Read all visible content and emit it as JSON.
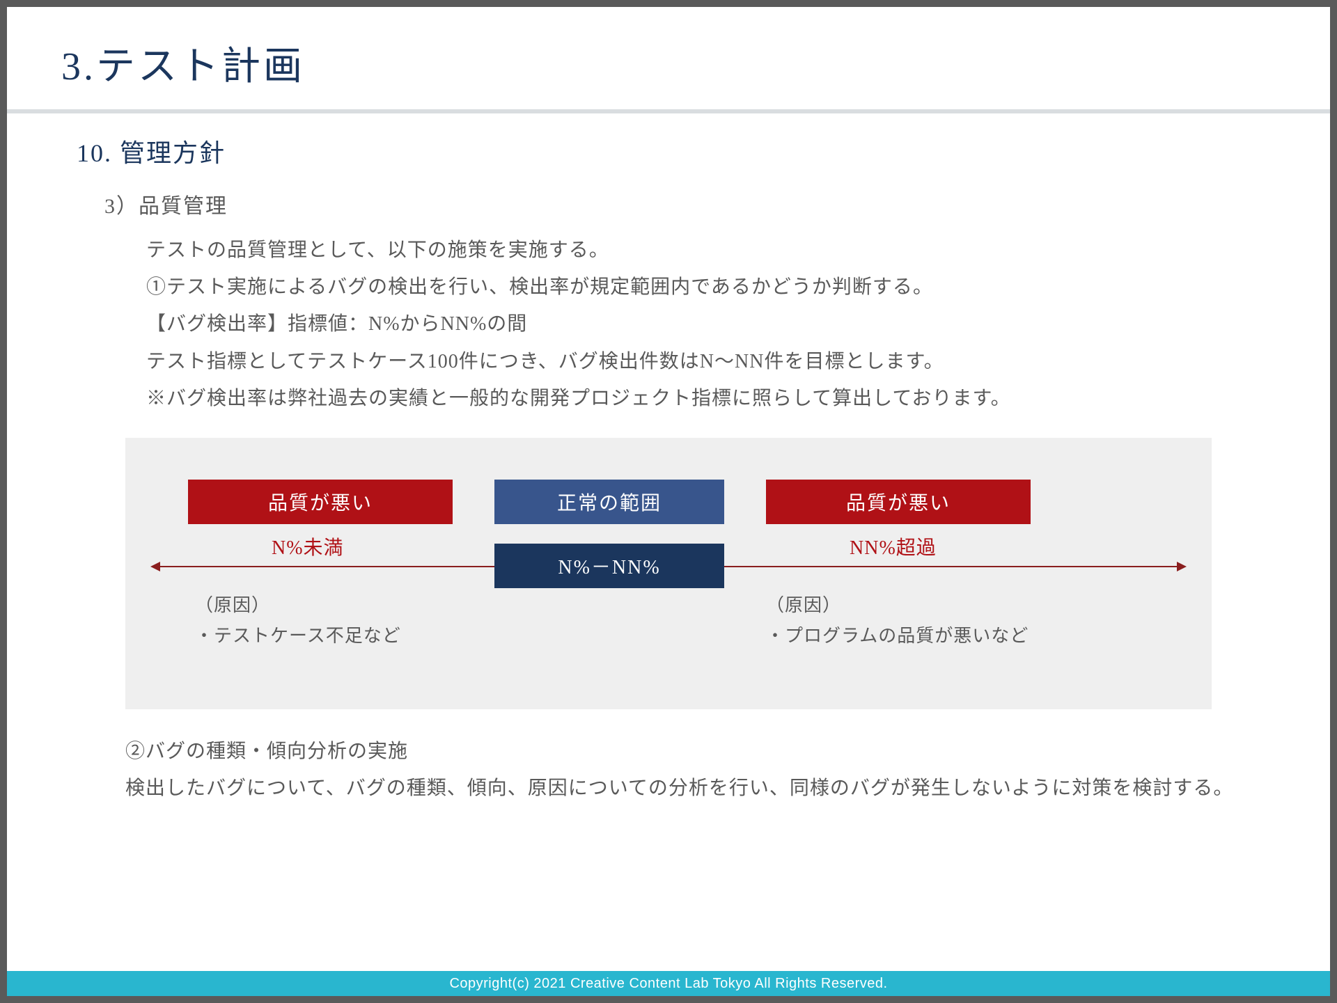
{
  "header": {
    "main_title": "3.テスト計画",
    "subtitle": "10. 管理方針",
    "section_label": "3）品質管理"
  },
  "body": {
    "line1": "テストの品質管理として、以下の施策を実施する。",
    "line2": "①テスト実施によるバグの検出を行い、検出率が規定範囲内であるかどうか判断する。",
    "line3": "【バグ検出率】指標値：N%からNN%の間",
    "line4": "テスト指標としてテストケース100件につき、バグ検出件数はN～NN件を目標とします。",
    "line5": "※バグ検出率は弊社過去の実績と一般的な開発プロジェクト指標に照らして算出しております。"
  },
  "chart_data": {
    "type": "range-axis",
    "left_box": {
      "label": "品質が悪い",
      "range_text": "N%未満",
      "cause_title": "（原因）",
      "cause_text": "・テストケース不足など"
    },
    "center_box": {
      "label_top": "正常の範囲",
      "label_bottom": "N%－NN%"
    },
    "right_box": {
      "label": "品質が悪い",
      "range_text": "NN%超過",
      "cause_title": "（原因）",
      "cause_text": "・プログラムの品質が悪いなど"
    }
  },
  "body2": {
    "line1": "②バグの種類・傾向分析の実施",
    "line2": "検出したバグについて、バグの種類、傾向、原因についての分析を行い、同様のバグが発生しないように対策を検討する。"
  },
  "footer": {
    "copyright": "Copyright(c) 2021 Creative Content Lab Tokyo All Rights Reserved."
  }
}
